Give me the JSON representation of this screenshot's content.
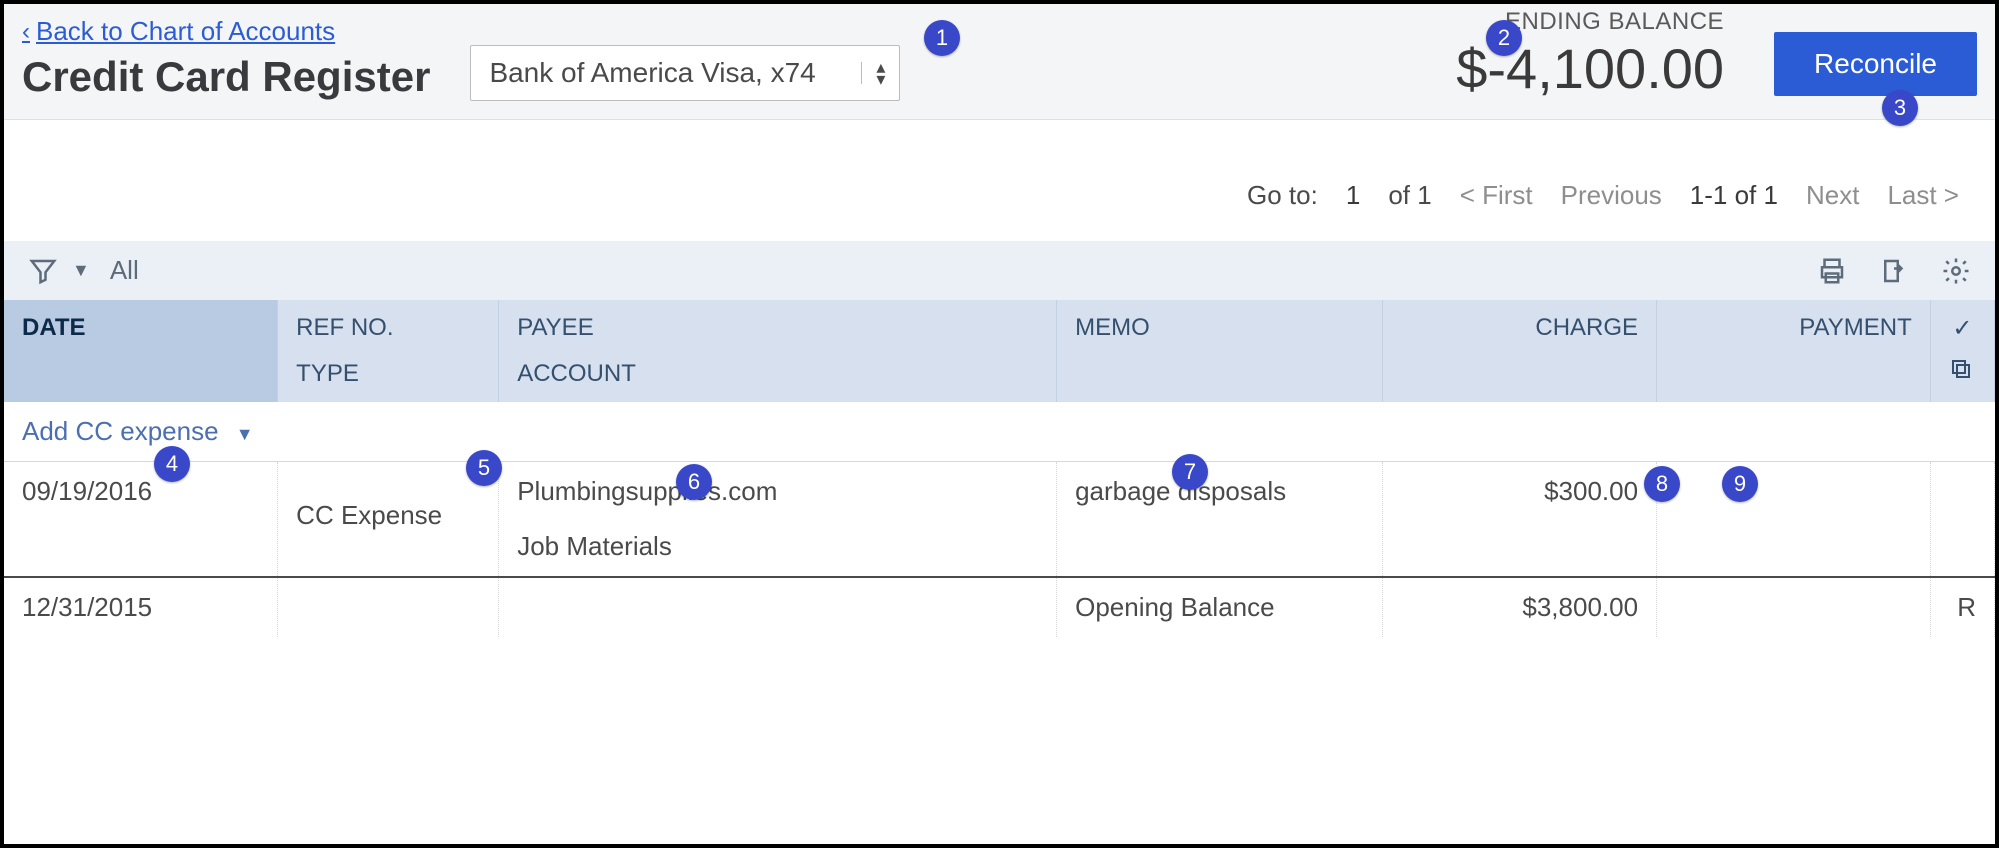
{
  "header": {
    "back_link": "Back to Chart of Accounts",
    "title": "Credit Card Register",
    "account_selected": "Bank of America Visa, x74",
    "ending_balance_label": "ENDING BALANCE",
    "ending_balance_value": "$-4,100.00",
    "reconcile_label": "Reconcile"
  },
  "pager": {
    "goto_label": "Go to:",
    "page_input": "1",
    "of_label": "of 1",
    "first": "< First",
    "prev": "Previous",
    "range": "1-1 of 1",
    "next": "Next",
    "last": "Last >"
  },
  "toolbar": {
    "filter_label": "All"
  },
  "columns": {
    "date": "DATE",
    "refno": "REF NO.",
    "type": "TYPE",
    "payee": "PAYEE",
    "account": "ACCOUNT",
    "memo": "MEMO",
    "charge": "CHARGE",
    "payment": "PAYMENT"
  },
  "add_row_label": "Add CC expense",
  "rows": [
    {
      "date": "09/19/2016",
      "refno": "",
      "type": "CC Expense",
      "payee": "Plumbingsupplies.com",
      "account": "Job Materials",
      "memo": "garbage disposals",
      "charge": "$300.00",
      "payment": "",
      "rec": ""
    },
    {
      "date": "12/31/2015",
      "refno": "",
      "type": "",
      "payee": "",
      "account": "",
      "memo": "Opening Balance",
      "charge": "$3,800.00",
      "payment": "",
      "rec": "R"
    }
  ],
  "callouts": {
    "1": "1",
    "2": "2",
    "3": "3",
    "4": "4",
    "5": "5",
    "6": "6",
    "7": "7",
    "8": "8",
    "9": "9"
  }
}
